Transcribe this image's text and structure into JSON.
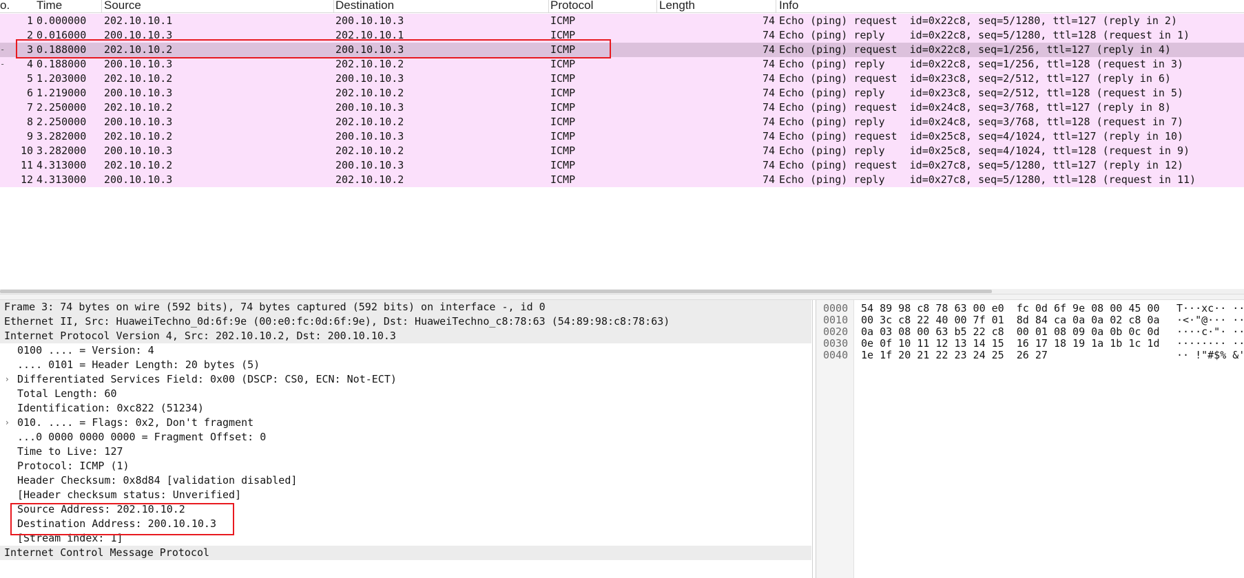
{
  "columns": {
    "no": "o.",
    "time": "Time",
    "source": "Source",
    "destination": "Destination",
    "protocol": "Protocol",
    "length": "Length",
    "info": "Info"
  },
  "packets": [
    {
      "no": "1",
      "time": "0.000000",
      "source": "202.10.10.1",
      "destination": "200.10.10.3",
      "protocol": "ICMP",
      "length": "74",
      "info": "Echo (ping) request  id=0x22c8, seq=5/1280, ttl=127 (reply in 2)",
      "marker": ""
    },
    {
      "no": "2",
      "time": "0.016000",
      "source": "200.10.10.3",
      "destination": "202.10.10.1",
      "protocol": "ICMP",
      "length": "74",
      "info": "Echo (ping) reply    id=0x22c8, seq=5/1280, ttl=128 (request in 1)",
      "marker": ""
    },
    {
      "no": "3",
      "time": "0.188000",
      "source": "202.10.10.2",
      "destination": "200.10.10.3",
      "protocol": "ICMP",
      "length": "74",
      "info": "Echo (ping) request  id=0x22c8, seq=1/256, ttl=127 (reply in 4)",
      "marker": "-",
      "selected": true
    },
    {
      "no": "4",
      "time": "0.188000",
      "source": "200.10.10.3",
      "destination": "202.10.10.2",
      "protocol": "ICMP",
      "length": "74",
      "info": "Echo (ping) reply    id=0x22c8, seq=1/256, ttl=128 (request in 3)",
      "marker": "-"
    },
    {
      "no": "5",
      "time": "1.203000",
      "source": "202.10.10.2",
      "destination": "200.10.10.3",
      "protocol": "ICMP",
      "length": "74",
      "info": "Echo (ping) request  id=0x23c8, seq=2/512, ttl=127 (reply in 6)",
      "marker": ""
    },
    {
      "no": "6",
      "time": "1.219000",
      "source": "200.10.10.3",
      "destination": "202.10.10.2",
      "protocol": "ICMP",
      "length": "74",
      "info": "Echo (ping) reply    id=0x23c8, seq=2/512, ttl=128 (request in 5)",
      "marker": ""
    },
    {
      "no": "7",
      "time": "2.250000",
      "source": "202.10.10.2",
      "destination": "200.10.10.3",
      "protocol": "ICMP",
      "length": "74",
      "info": "Echo (ping) request  id=0x24c8, seq=3/768, ttl=127 (reply in 8)",
      "marker": ""
    },
    {
      "no": "8",
      "time": "2.250000",
      "source": "200.10.10.3",
      "destination": "202.10.10.2",
      "protocol": "ICMP",
      "length": "74",
      "info": "Echo (ping) reply    id=0x24c8, seq=3/768, ttl=128 (request in 7)",
      "marker": ""
    },
    {
      "no": "9",
      "time": "3.282000",
      "source": "202.10.10.2",
      "destination": "200.10.10.3",
      "protocol": "ICMP",
      "length": "74",
      "info": "Echo (ping) request  id=0x25c8, seq=4/1024, ttl=127 (reply in 10)",
      "marker": ""
    },
    {
      "no": "10",
      "time": "3.282000",
      "source": "200.10.10.3",
      "destination": "202.10.10.2",
      "protocol": "ICMP",
      "length": "74",
      "info": "Echo (ping) reply    id=0x25c8, seq=4/1024, ttl=128 (request in 9)",
      "marker": ""
    },
    {
      "no": "11",
      "time": "4.313000",
      "source": "202.10.10.2",
      "destination": "200.10.10.3",
      "protocol": "ICMP",
      "length": "74",
      "info": "Echo (ping) request  id=0x27c8, seq=5/1280, ttl=127 (reply in 12)",
      "marker": ""
    },
    {
      "no": "12",
      "time": "4.313000",
      "source": "200.10.10.3",
      "destination": "202.10.10.2",
      "protocol": "ICMP",
      "length": "74",
      "info": "Echo (ping) reply    id=0x27c8, seq=5/1280, ttl=128 (request in 11)",
      "marker": ""
    }
  ],
  "details": [
    {
      "level": 0,
      "text": "Frame 3: 74 bytes on wire (592 bits), 74 bytes captured (592 bits) on interface -, id 0",
      "style": "shaded",
      "caret": ""
    },
    {
      "level": 0,
      "text": "Ethernet II, Src: HuaweiTechno_0d:6f:9e (00:e0:fc:0d:6f:9e), Dst: HuaweiTechno_c8:78:63 (54:89:98:c8:78:63)",
      "style": "shaded",
      "caret": ""
    },
    {
      "level": 0,
      "text": "Internet Protocol Version 4, Src: 202.10.10.2, Dst: 200.10.10.3",
      "style": "shaded",
      "caret": ""
    },
    {
      "level": 1,
      "text": "0100 .... = Version: 4",
      "style": "open",
      "caret": ""
    },
    {
      "level": 1,
      "text": ".... 0101 = Header Length: 20 bytes (5)",
      "style": "open",
      "caret": ""
    },
    {
      "level": 1,
      "text": "Differentiated Services Field: 0x00 (DSCP: CS0, ECN: Not-ECT)",
      "style": "open",
      "caret": "›"
    },
    {
      "level": 1,
      "text": "Total Length: 60",
      "style": "open",
      "caret": ""
    },
    {
      "level": 1,
      "text": "Identification: 0xc822 (51234)",
      "style": "open",
      "caret": ""
    },
    {
      "level": 1,
      "text": "010. .... = Flags: 0x2, Don't fragment",
      "style": "open",
      "caret": "›"
    },
    {
      "level": 1,
      "text": "...0 0000 0000 0000 = Fragment Offset: 0",
      "style": "open",
      "caret": ""
    },
    {
      "level": 1,
      "text": "Time to Live: 127",
      "style": "open",
      "caret": ""
    },
    {
      "level": 1,
      "text": "Protocol: ICMP (1)",
      "style": "open",
      "caret": ""
    },
    {
      "level": 1,
      "text": "Header Checksum: 0x8d84 [validation disabled]",
      "style": "open",
      "caret": ""
    },
    {
      "level": 1,
      "text": "[Header checksum status: Unverified]",
      "style": "open",
      "caret": ""
    },
    {
      "level": 1,
      "text": "Source Address: 202.10.10.2",
      "style": "open",
      "caret": ""
    },
    {
      "level": 1,
      "text": "Destination Address: 200.10.10.3",
      "style": "open",
      "caret": ""
    },
    {
      "level": 1,
      "text": "[Stream index: 1]",
      "style": "open",
      "caret": ""
    },
    {
      "level": 0,
      "text": "Internet Control Message Protocol",
      "style": "shaded",
      "caret": ""
    }
  ],
  "bytes": [
    {
      "offset": "0000",
      "hex": "54 89 98 c8 78 63 00 e0  fc 0d 6f 9e 08 00 45 00",
      "ascii": "T···xc·· ··o···E·"
    },
    {
      "offset": "0010",
      "hex": "00 3c c8 22 40 00 7f 01  8d 84 ca 0a 0a 02 c8 0a",
      "ascii": "·<·\"@··· ········"
    },
    {
      "offset": "0020",
      "hex": "0a 03 08 00 63 b5 22 c8  00 01 08 09 0a 0b 0c 0d",
      "ascii": "····c·\"· ········"
    },
    {
      "offset": "0030",
      "hex": "0e 0f 10 11 12 13 14 15  16 17 18 19 1a 1b 1c 1d",
      "ascii": "········ ········"
    },
    {
      "offset": "0040",
      "hex": "1e 1f 20 21 22 23 24 25  26 27",
      "ascii": "·· !\"#$% &'"
    }
  ],
  "colors": {
    "row_icmp": "#fbe0fb",
    "row_selected": "#dcc1dc",
    "highlight_box": "#e8191f"
  }
}
